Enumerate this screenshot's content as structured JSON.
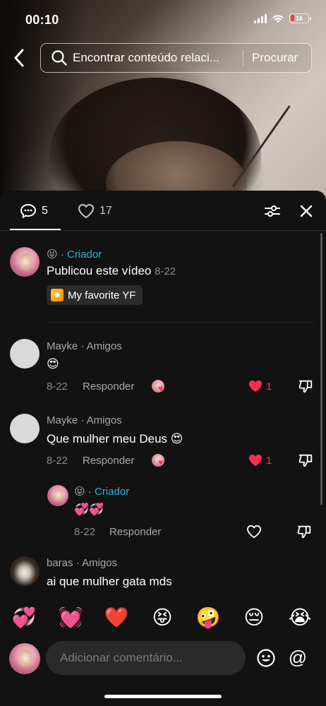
{
  "status_bar": {
    "time": "00:10",
    "battery_level": "16",
    "icons": [
      "signal-icon",
      "wifi-icon",
      "battery-icon"
    ]
  },
  "search": {
    "placeholder": "Encontrar conteúdo relaci...",
    "button": "Procurar"
  },
  "tabs": {
    "comments_count": "5",
    "likes_count": "17"
  },
  "creator_post": {
    "name_emoji": "😝",
    "separator": "·",
    "creator_label": "Criador",
    "text": "Publicou este vídeo",
    "date": "8-22",
    "tag_label": "My favorite YF"
  },
  "comments": [
    {
      "author": "Mayke · Amigos",
      "text": "😍",
      "date": "8-22",
      "reply_label": "Responder",
      "likes": "1",
      "liked": true,
      "liked_by_creator": true
    },
    {
      "author": "Mayke · Amigos",
      "text": "Que mulher meu Deus 😍",
      "date": "8-22",
      "reply_label": "Responder",
      "likes": "1",
      "liked": true,
      "liked_by_creator": true,
      "reply": {
        "name_emoji": "😝",
        "separator": "·",
        "creator_label": "Criador",
        "text": "💞💞",
        "date": "8-22",
        "reply_label": "Responder"
      }
    },
    {
      "author": "baras · Amigos",
      "text": "ai que mulher gata mds"
    }
  ],
  "emoji_bar": [
    "💞",
    "💓",
    "❤️",
    "😝",
    "🤪",
    "😔",
    "😭"
  ],
  "input": {
    "placeholder": "Adicionar comentário...",
    "mention_symbol": "@"
  },
  "colors": {
    "accent_creator": "#29b1e0",
    "like_red": "#fe2c55",
    "sheet_bg": "#121212"
  }
}
